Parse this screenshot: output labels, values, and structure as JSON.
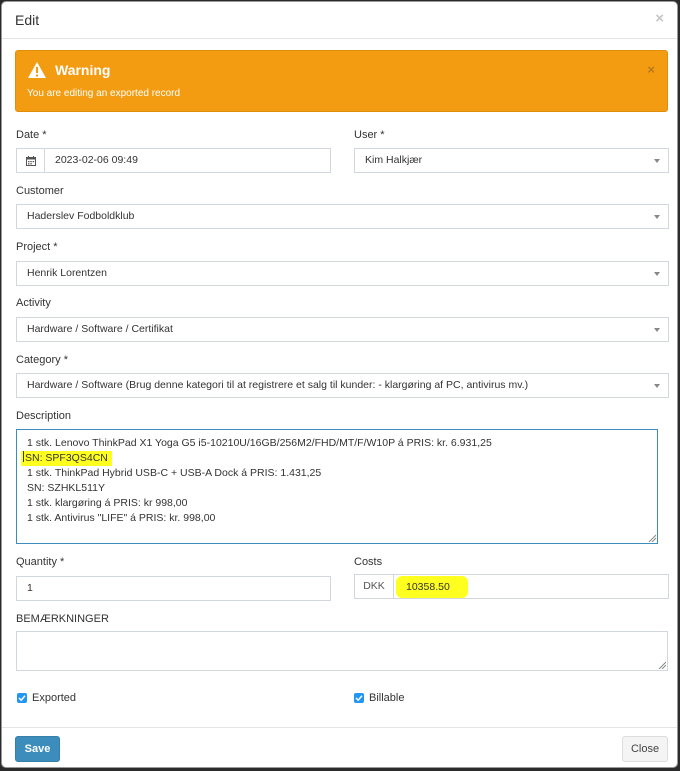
{
  "modal": {
    "title": "Edit"
  },
  "alert": {
    "title": "Warning",
    "text": "You are editing an exported record",
    "color": "#f39c12"
  },
  "form": {
    "date": {
      "label": "Date *",
      "value": "2023-02-06 09:49"
    },
    "user": {
      "label": "User *",
      "value": "Kim Halkjær"
    },
    "customer": {
      "label": "Customer",
      "value": "Haderslev Fodboldklub"
    },
    "project": {
      "label": "Project *",
      "value": "Henrik Lorentzen"
    },
    "activity": {
      "label": "Activity",
      "value": "Hardware / Software / Certifikat"
    },
    "category": {
      "label": "Category *",
      "value": "Hardware / Software (Brug denne kategori til at registrere et salg til kunder: - klargøring af PC, antivirus mv.)"
    },
    "description": {
      "label": "Description",
      "lines": [
        "1 stk. Lenovo ThinkPad X1 Yoga G5 i5-10210U/16GB/256M2/FHD/MT/F/W10P á PRIS: kr. 6.931,25",
        "SN: SPF3QS4CN",
        "1 stk. ThinkPad Hybrid USB-C + USB-A Dock á PRIS: 1.431,25",
        "SN: SZHKL511Y",
        "1 stk. klargøring á PRIS: kr 998,00",
        "1 stk. Antivirus \"LIFE\" á PRIS: kr. 998,00"
      ]
    },
    "quantity": {
      "label": "Quantity *",
      "value": "1"
    },
    "costs": {
      "label": "Costs",
      "currency": "DKK",
      "value": "10358.50"
    },
    "remarks": {
      "label": "BEMÆRKNINGER",
      "value": ""
    },
    "exported": {
      "label": "Exported",
      "checked": true
    },
    "billable": {
      "label": "Billable",
      "checked": true
    }
  },
  "buttons": {
    "save": "Save",
    "close": "Close"
  },
  "colors": {
    "primary": "#3c8dbc",
    "highlight": "#ffff20",
    "checkbox": "#2196f3"
  }
}
